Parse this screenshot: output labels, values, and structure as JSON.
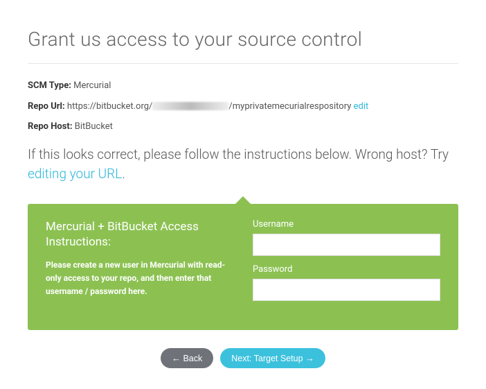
{
  "page": {
    "title": "Grant us access to your source control"
  },
  "info": {
    "scm_type_label": "SCM Type:",
    "scm_type_value": "Mercurial",
    "repo_url_label": "Repo Url:",
    "repo_url_prefix": "https://bitbucket.org/",
    "repo_url_suffix": "/myprivatemecurialrespository",
    "edit_link": "edit",
    "repo_host_label": "Repo Host:",
    "repo_host_value": "BitBucket"
  },
  "instruction": {
    "text_before": "If this looks correct, please follow the instructions below. Wrong host? Try ",
    "link_text": "editing your URL",
    "text_after": "."
  },
  "panel": {
    "title": "Mercurial + BitBucket Access Instructions:",
    "body": "Please create a new user in Mercurial with read-only access to your repo, and then enter that username / password here.",
    "username_label": "Username",
    "password_label": "Password"
  },
  "buttons": {
    "back": "Back",
    "next": "Next: Target Setup"
  },
  "glyphs": {
    "arrow_left": "←",
    "arrow_right": "→"
  }
}
